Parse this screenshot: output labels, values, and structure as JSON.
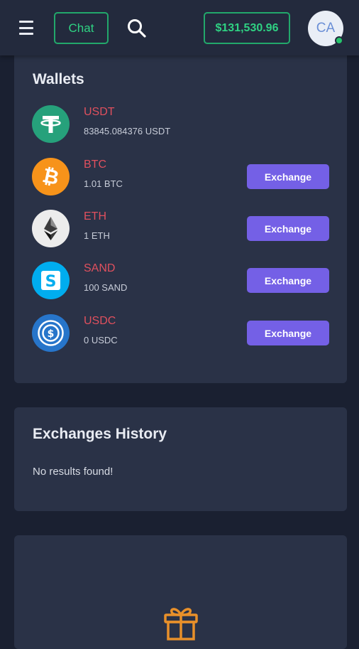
{
  "header": {
    "chat_label": "Chat",
    "balance": "$131,530.96",
    "avatar_initials": "CA"
  },
  "wallets": {
    "title": "Wallets",
    "exchange_label": "Exchange",
    "items": [
      {
        "symbol": "USDT",
        "amount": "83845.084376 USDT",
        "icon": "tether-icon",
        "color": "#26a17b"
      },
      {
        "symbol": "BTC",
        "amount": "1.01 BTC",
        "icon": "bitcoin-icon",
        "color": "#f7931a"
      },
      {
        "symbol": "ETH",
        "amount": "1 ETH",
        "icon": "ethereum-icon",
        "color": "#ececec"
      },
      {
        "symbol": "SAND",
        "amount": "100 SAND",
        "icon": "sandbox-icon",
        "color": "#00adef"
      },
      {
        "symbol": "USDC",
        "amount": "0 USDC",
        "icon": "usd-coin-icon",
        "color": "#2775ca"
      }
    ]
  },
  "history": {
    "title": "Exchanges History",
    "empty_message": "No results found!"
  },
  "colors": {
    "accent_green": "#2fd283",
    "exchange_button": "#7460e6",
    "coin_name_red": "#e0505e",
    "card_bg": "#2a3247",
    "page_bg": "#1a2031",
    "gift_orange": "#e8902a"
  }
}
